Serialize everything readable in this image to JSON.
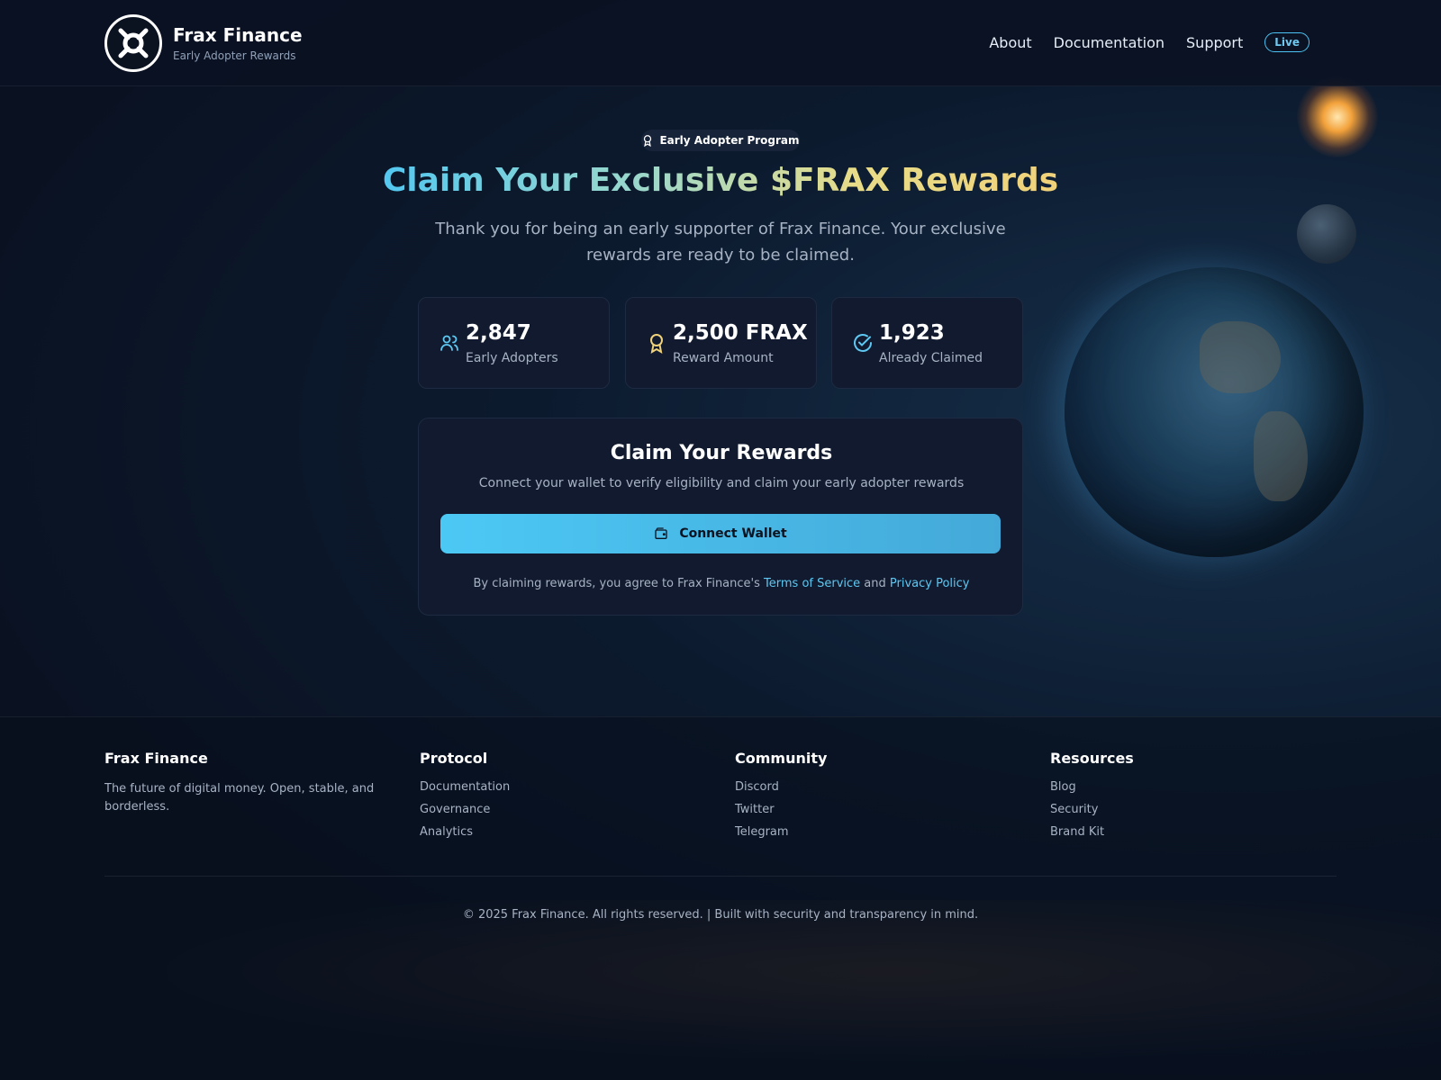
{
  "header": {
    "brand_title": "Frax Finance",
    "brand_subtitle": "Early Adopter Rewards",
    "nav": [
      "About",
      "Documentation",
      "Support"
    ],
    "live_badge": "Live"
  },
  "hero": {
    "pill_label": "Early Adopter Program",
    "headline": "Claim Your Exclusive $FRAX Rewards",
    "subtext": "Thank you for being an early supporter of Frax Finance. Your exclusive rewards are ready to be claimed."
  },
  "stats": [
    {
      "value": "2,847",
      "label": "Early Adopters",
      "icon": "users-icon",
      "color": "#5ec8f2"
    },
    {
      "value": "2,500 FRAX",
      "label": "Reward Amount",
      "icon": "award-icon",
      "color": "#f0d27a"
    },
    {
      "value": "1,923",
      "label": "Already Claimed",
      "icon": "check-circle-icon",
      "color": "#5ec8f2"
    }
  ],
  "claim": {
    "title": "Claim Your Rewards",
    "description": "Connect your wallet to verify eligibility and claim your early adopter rewards",
    "button_label": "Connect Wallet",
    "legal_prefix": "By claiming rewards, you agree to Frax Finance's",
    "terms_label": "Terms of Service",
    "legal_and": "and",
    "privacy_label": "Privacy Policy"
  },
  "footer": {
    "brand_title": "Frax Finance",
    "brand_desc": "The future of digital money. Open, stable, and borderless.",
    "columns": [
      {
        "title": "Protocol",
        "links": [
          "Documentation",
          "Governance",
          "Analytics"
        ]
      },
      {
        "title": "Community",
        "links": [
          "Discord",
          "Twitter",
          "Telegram"
        ]
      },
      {
        "title": "Resources",
        "links": [
          "Blog",
          "Security",
          "Brand Kit"
        ]
      }
    ],
    "copyright": "© 2025 Frax Finance. All rights reserved. | Built with security and transparency in mind."
  },
  "colors": {
    "accent": "#4cc3f2",
    "gold": "#f0d27a",
    "background": "#0a1222",
    "card": "#111a2e"
  }
}
